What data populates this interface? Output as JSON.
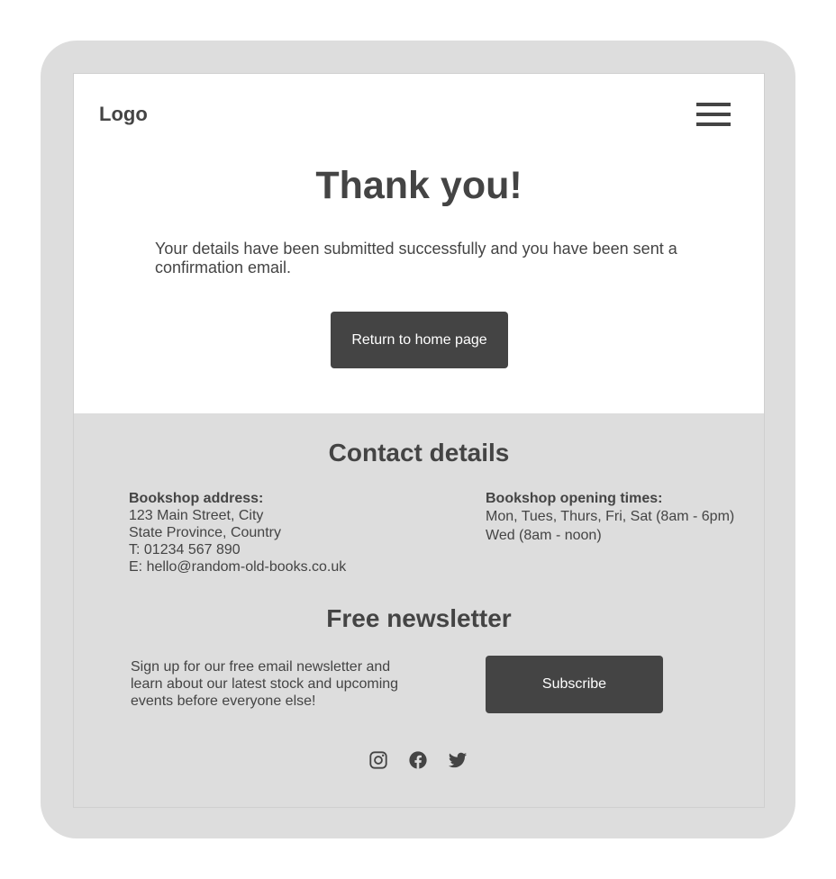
{
  "header": {
    "logo": "Logo",
    "menu_icon": "hamburger-menu-icon"
  },
  "main": {
    "title": "Thank you!",
    "message": "Your details have been submitted successfully and you have been sent a confirmation email.",
    "return_button_label": "Return to home page"
  },
  "contact": {
    "title": "Contact details",
    "address_heading": "Bookshop address:",
    "address_line1": "123 Main Street, City",
    "address_line2": "State Province, Country",
    "phone": "T: 01234 567 890",
    "email": "E: hello@random-old-books.co.uk",
    "hours_heading": "Bookshop opening times:",
    "hours_line1": "Mon, Tues, Thurs, Fri, Sat (8am - 6pm)",
    "hours_line2": "Wed (8am - noon)"
  },
  "newsletter": {
    "title": "Free newsletter",
    "text": "Sign up for our free email newsletter and learn about our latest stock and upcoming events before everyone else!",
    "subscribe_label": "Subscribe"
  },
  "social": {
    "icons": [
      "instagram-icon",
      "facebook-icon",
      "twitter-icon"
    ]
  },
  "colors": {
    "dark": "#444444",
    "frame": "#dddddd",
    "background": "#ffffff"
  }
}
